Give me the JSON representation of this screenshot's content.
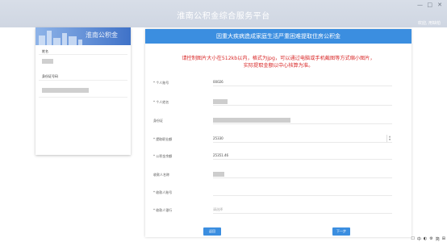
{
  "window": {
    "minimize": "—",
    "maximize": "□",
    "close": "✕"
  },
  "header": {
    "title": "淮南公积金综合服务平台",
    "greeting": "欢迎, 用缺柏"
  },
  "sidebar": {
    "banner_text": "淮南公积金",
    "name_label": "姓名",
    "id_label": "身份证号码"
  },
  "panel": {
    "title": "因重大疾病造成家庭生活严重困难提取住房公积金",
    "notice_line1": "请控制图片大小在512kb以内，格式为jpg，可以通过电脑或手机截图等方式缩小图片，",
    "notice_line2": "实际提取金额以中心核算为准。",
    "fields": [
      {
        "label": "* 个人账号",
        "value": "00026"
      },
      {
        "label": "* 个人姓名",
        "value": ""
      },
      {
        "label": "身份证",
        "value": ""
      },
      {
        "label": "* 提取职业额",
        "value": "25330"
      },
      {
        "label": "* 公积金余额",
        "value": "25351.46"
      },
      {
        "label": "收款人名称",
        "value": ""
      },
      {
        "label": "* 收款人账号",
        "value": ""
      },
      {
        "label": "* 收款人银行",
        "value": "请选择"
      }
    ],
    "back_button": "返回",
    "next_button": "下一步"
  },
  "tray": {
    "items": [
      "☐",
      "中",
      "◐",
      "⚙",
      "简",
      "⊞"
    ]
  }
}
